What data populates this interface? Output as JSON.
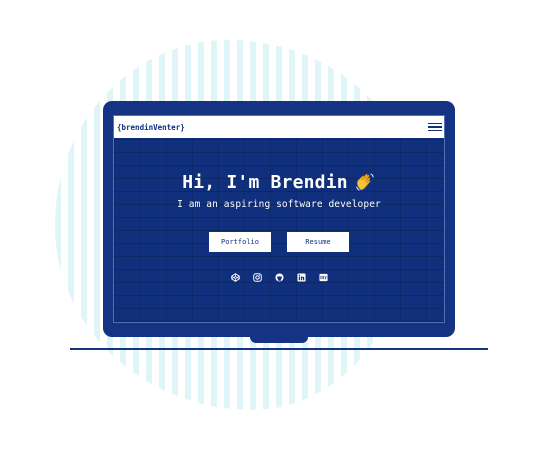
{
  "navbar": {
    "logo": "{brendinVenter}"
  },
  "hero": {
    "title": "Hi, I'm Brendin",
    "subtitle": "I am an aspiring software developer"
  },
  "buttons": {
    "portfolio": "Portfolio",
    "resume": "Resume"
  },
  "socials": [
    "codepen-icon",
    "instagram-icon",
    "github-icon",
    "linkedin-icon",
    "dev-icon"
  ],
  "colors": {
    "brand_blue": "#143383",
    "screen_blue": "#10307e",
    "blob_stripe": "#dff5f7"
  }
}
